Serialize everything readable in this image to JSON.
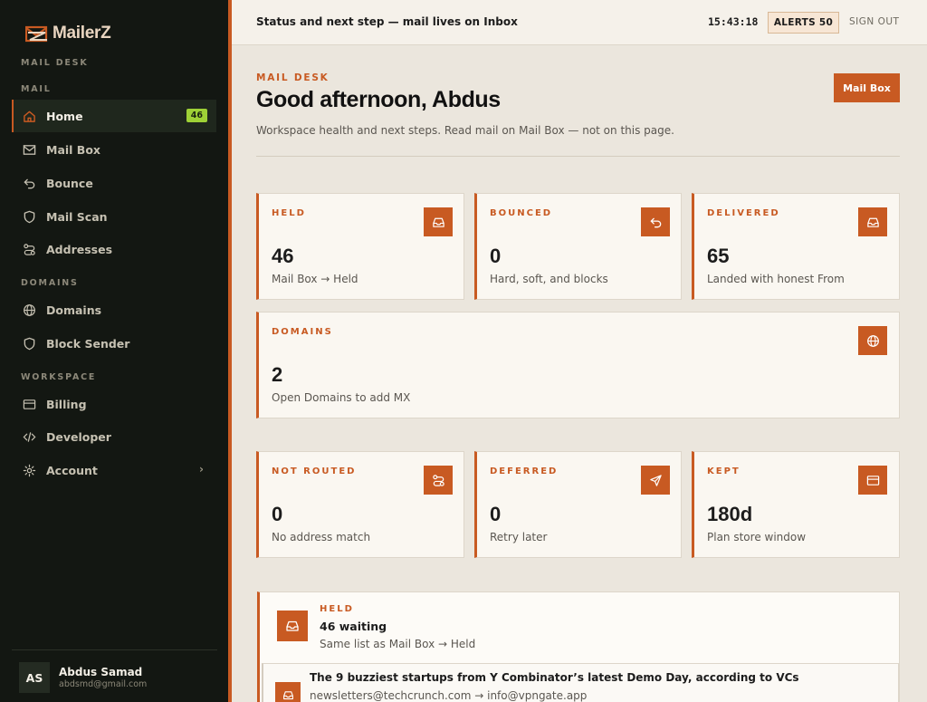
{
  "app": {
    "name": "MailerZ",
    "desk_label": "MAIL DESK"
  },
  "sidebar": {
    "sections": {
      "mail": "MAIL",
      "domains": "DOMAINS",
      "workspace": "WORKSPACE"
    },
    "items": [
      {
        "label": "Home",
        "icon": "home-icon",
        "badge": "46",
        "active": true
      },
      {
        "label": "Mail Box",
        "icon": "mail-icon"
      },
      {
        "label": "Bounce",
        "icon": "bounce-icon"
      },
      {
        "label": "Mail Scan",
        "icon": "shield-icon"
      },
      {
        "label": "Addresses",
        "icon": "route-icon"
      },
      {
        "label": "Domains",
        "icon": "globe-icon"
      },
      {
        "label": "Block Sender",
        "icon": "shield-icon"
      },
      {
        "label": "Billing",
        "icon": "card-icon"
      },
      {
        "label": "Developer",
        "icon": "code-icon"
      },
      {
        "label": "Account",
        "icon": "gear-icon",
        "chevron": "›"
      }
    ],
    "user": {
      "initials": "AS",
      "name": "Abdus Samad",
      "email": "abdsmd@gmail.com"
    }
  },
  "topbar": {
    "status": "Status and next step — mail lives on Inbox",
    "time": "15:43:18",
    "alerts_label": "ALERTS 50",
    "signout_label": "SIGN OUT"
  },
  "header": {
    "eyebrow": "MAIL DESK",
    "greeting": "Good afternoon, Abdus",
    "subtitle": "Workspace health and next steps. Read mail on Mail Box — not on this page.",
    "mailbox_button": "Mail Box"
  },
  "stats": [
    {
      "label": "HELD",
      "value": "46",
      "desc": "Mail Box → Held",
      "icon": "inbox-icon"
    },
    {
      "label": "BOUNCED",
      "value": "0",
      "desc": "Hard, soft, and blocks",
      "icon": "bounce-icon"
    },
    {
      "label": "DELIVERED",
      "value": "65",
      "desc": "Landed with honest From",
      "icon": "inbox-icon"
    },
    {
      "label": "DOMAINS",
      "value": "2",
      "desc": "Open Domains to add MX",
      "icon": "globe-icon"
    },
    {
      "label": "NOT ROUTED",
      "value": "0",
      "desc": "No address match",
      "icon": "route-icon"
    },
    {
      "label": "DEFERRED",
      "value": "0",
      "desc": "Retry later",
      "icon": "send-icon"
    },
    {
      "label": "KEPT",
      "value": "180d",
      "desc": "Plan store window",
      "icon": "card-icon"
    }
  ],
  "held_panel": {
    "label": "HELD",
    "count": "46 waiting",
    "desc": "Same list as Mail Box → Held",
    "messages": [
      {
        "subject": "The 9 buzziest startups from Y Combinator’s latest Demo Day, according to VCs",
        "route": "newsletters@techcrunch.com → info@vpngate.app"
      }
    ]
  },
  "colors": {
    "accent": "#c85a22",
    "sidebar_bg": "#131712",
    "badge": "#9ed136",
    "page_bg": "#ebe6dd"
  }
}
